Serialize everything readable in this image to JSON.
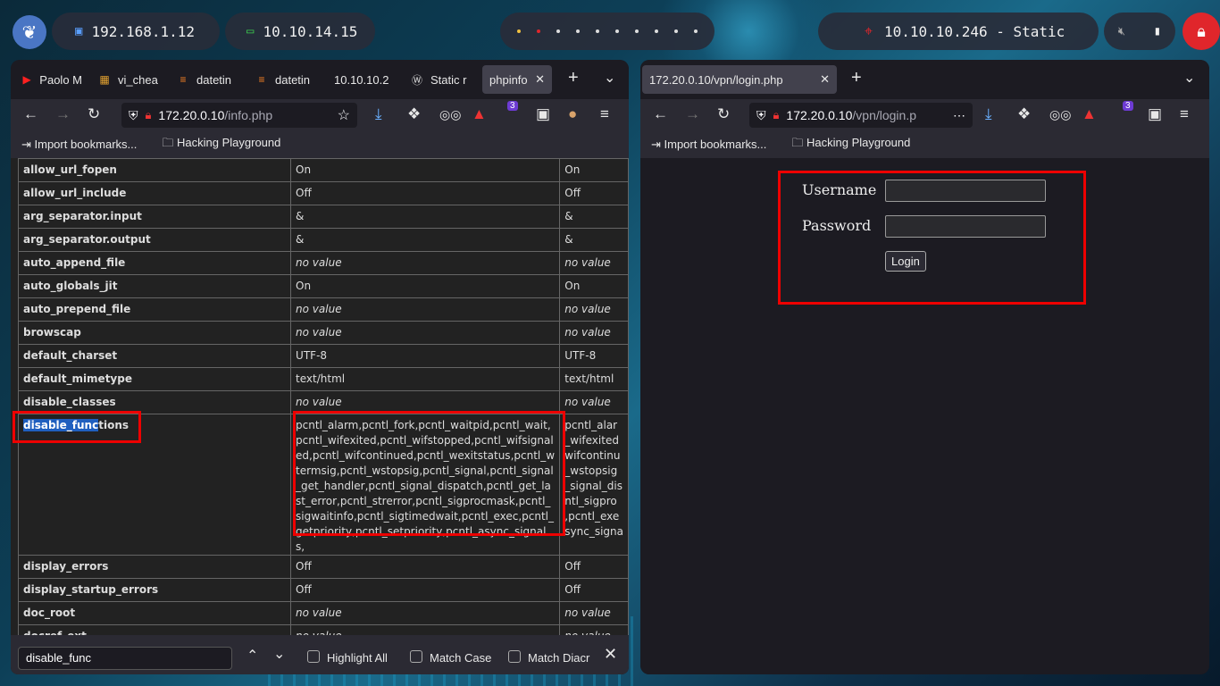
{
  "panel": {
    "ip_local": "192.168.1.12",
    "ip_vpn": "10.10.14.15",
    "target": "10.10.10.246 - Static",
    "colors": {
      "lock": "#e0262b",
      "vpn_icon": "#3ccf4e",
      "target_icon": "#e0262b"
    }
  },
  "left_browser": {
    "tabs": [
      "Paolo M",
      "vi_chea",
      "datetin",
      "datetin",
      "10.10.10.2",
      "Static r",
      "phpinfo"
    ],
    "url_host": "172.20.0.10",
    "url_path": "/info.php",
    "ext_badge": "3",
    "bookmarks": [
      "Import bookmarks...",
      "Hacking Playground"
    ],
    "rows": [
      {
        "k": "allow_url_fopen",
        "v": "On",
        "v2": "On"
      },
      {
        "k": "allow_url_include",
        "v": "Off",
        "v2": "Off"
      },
      {
        "k": "arg_separator.input",
        "v": "&",
        "v2": "&"
      },
      {
        "k": "arg_separator.output",
        "v": "&",
        "v2": "&"
      },
      {
        "k": "auto_append_file",
        "v": "no value",
        "v2": "no value"
      },
      {
        "k": "auto_globals_jit",
        "v": "On",
        "v2": "On"
      },
      {
        "k": "auto_prepend_file",
        "v": "no value",
        "v2": "no value"
      },
      {
        "k": "browscap",
        "v": "no value",
        "v2": "no value"
      },
      {
        "k": "default_charset",
        "v": "UTF-8",
        "v2": "UTF-8"
      },
      {
        "k": "default_mimetype",
        "v": "text/html",
        "v2": "text/html"
      },
      {
        "k": "disable_classes",
        "v": "no value",
        "v2": "no value"
      }
    ],
    "disable_row": {
      "k_hl": "disable_func",
      "k_rest": "tions",
      "v": "pcntl_alarm,pcntl_fork,pcntl_waitpid,pcntl_wait,pcntl_wifexited,pcntl_wifstopped,pcntl_wifsignaled,pcntl_wifcontinued,pcntl_wexitstatus,pcntl_wtermsig,pcntl_wstopsig,pcntl_signal,pcntl_signal_get_handler,pcntl_signal_dispatch,pcntl_get_last_error,pcntl_strerror,pcntl_sigprocmask,pcntl_sigwaitinfo,pcntl_sigtimedwait,pcntl_exec,pcntl_getpriority,pcntl_setpriority,pcntl_async_signals,",
      "v2_lines": [
        "pcntl_alar",
        "_wifexited",
        "wifcontinu",
        "_wstopsig",
        "_signal_dis",
        "ntl_sigpro",
        ",pcntl_exe",
        "sync_signa"
      ]
    },
    "rows_after": [
      {
        "k": "display_errors",
        "v": "Off",
        "v2": "Off"
      },
      {
        "k": "display_startup_errors",
        "v": "Off",
        "v2": "Off"
      },
      {
        "k": "doc_root",
        "v": "no value",
        "v2": "no value"
      },
      {
        "k": "docref_ext",
        "v": "no value",
        "v2": "no value"
      }
    ],
    "find": {
      "value": "disable_func",
      "highlight_all": "Highlight All",
      "match_case": "Match Case",
      "match_diacritics": "Match Diacr"
    }
  },
  "right_browser": {
    "tab": "172.20.0.10/vpn/login.php",
    "url_host": "172.20.0.10",
    "url_path": "/vpn/login.p",
    "ext_badge": "3",
    "bookmarks": [
      "Import bookmarks...",
      "Hacking Playground"
    ],
    "login": {
      "username_label": "Username",
      "password_label": "Password",
      "button": "Login"
    }
  }
}
